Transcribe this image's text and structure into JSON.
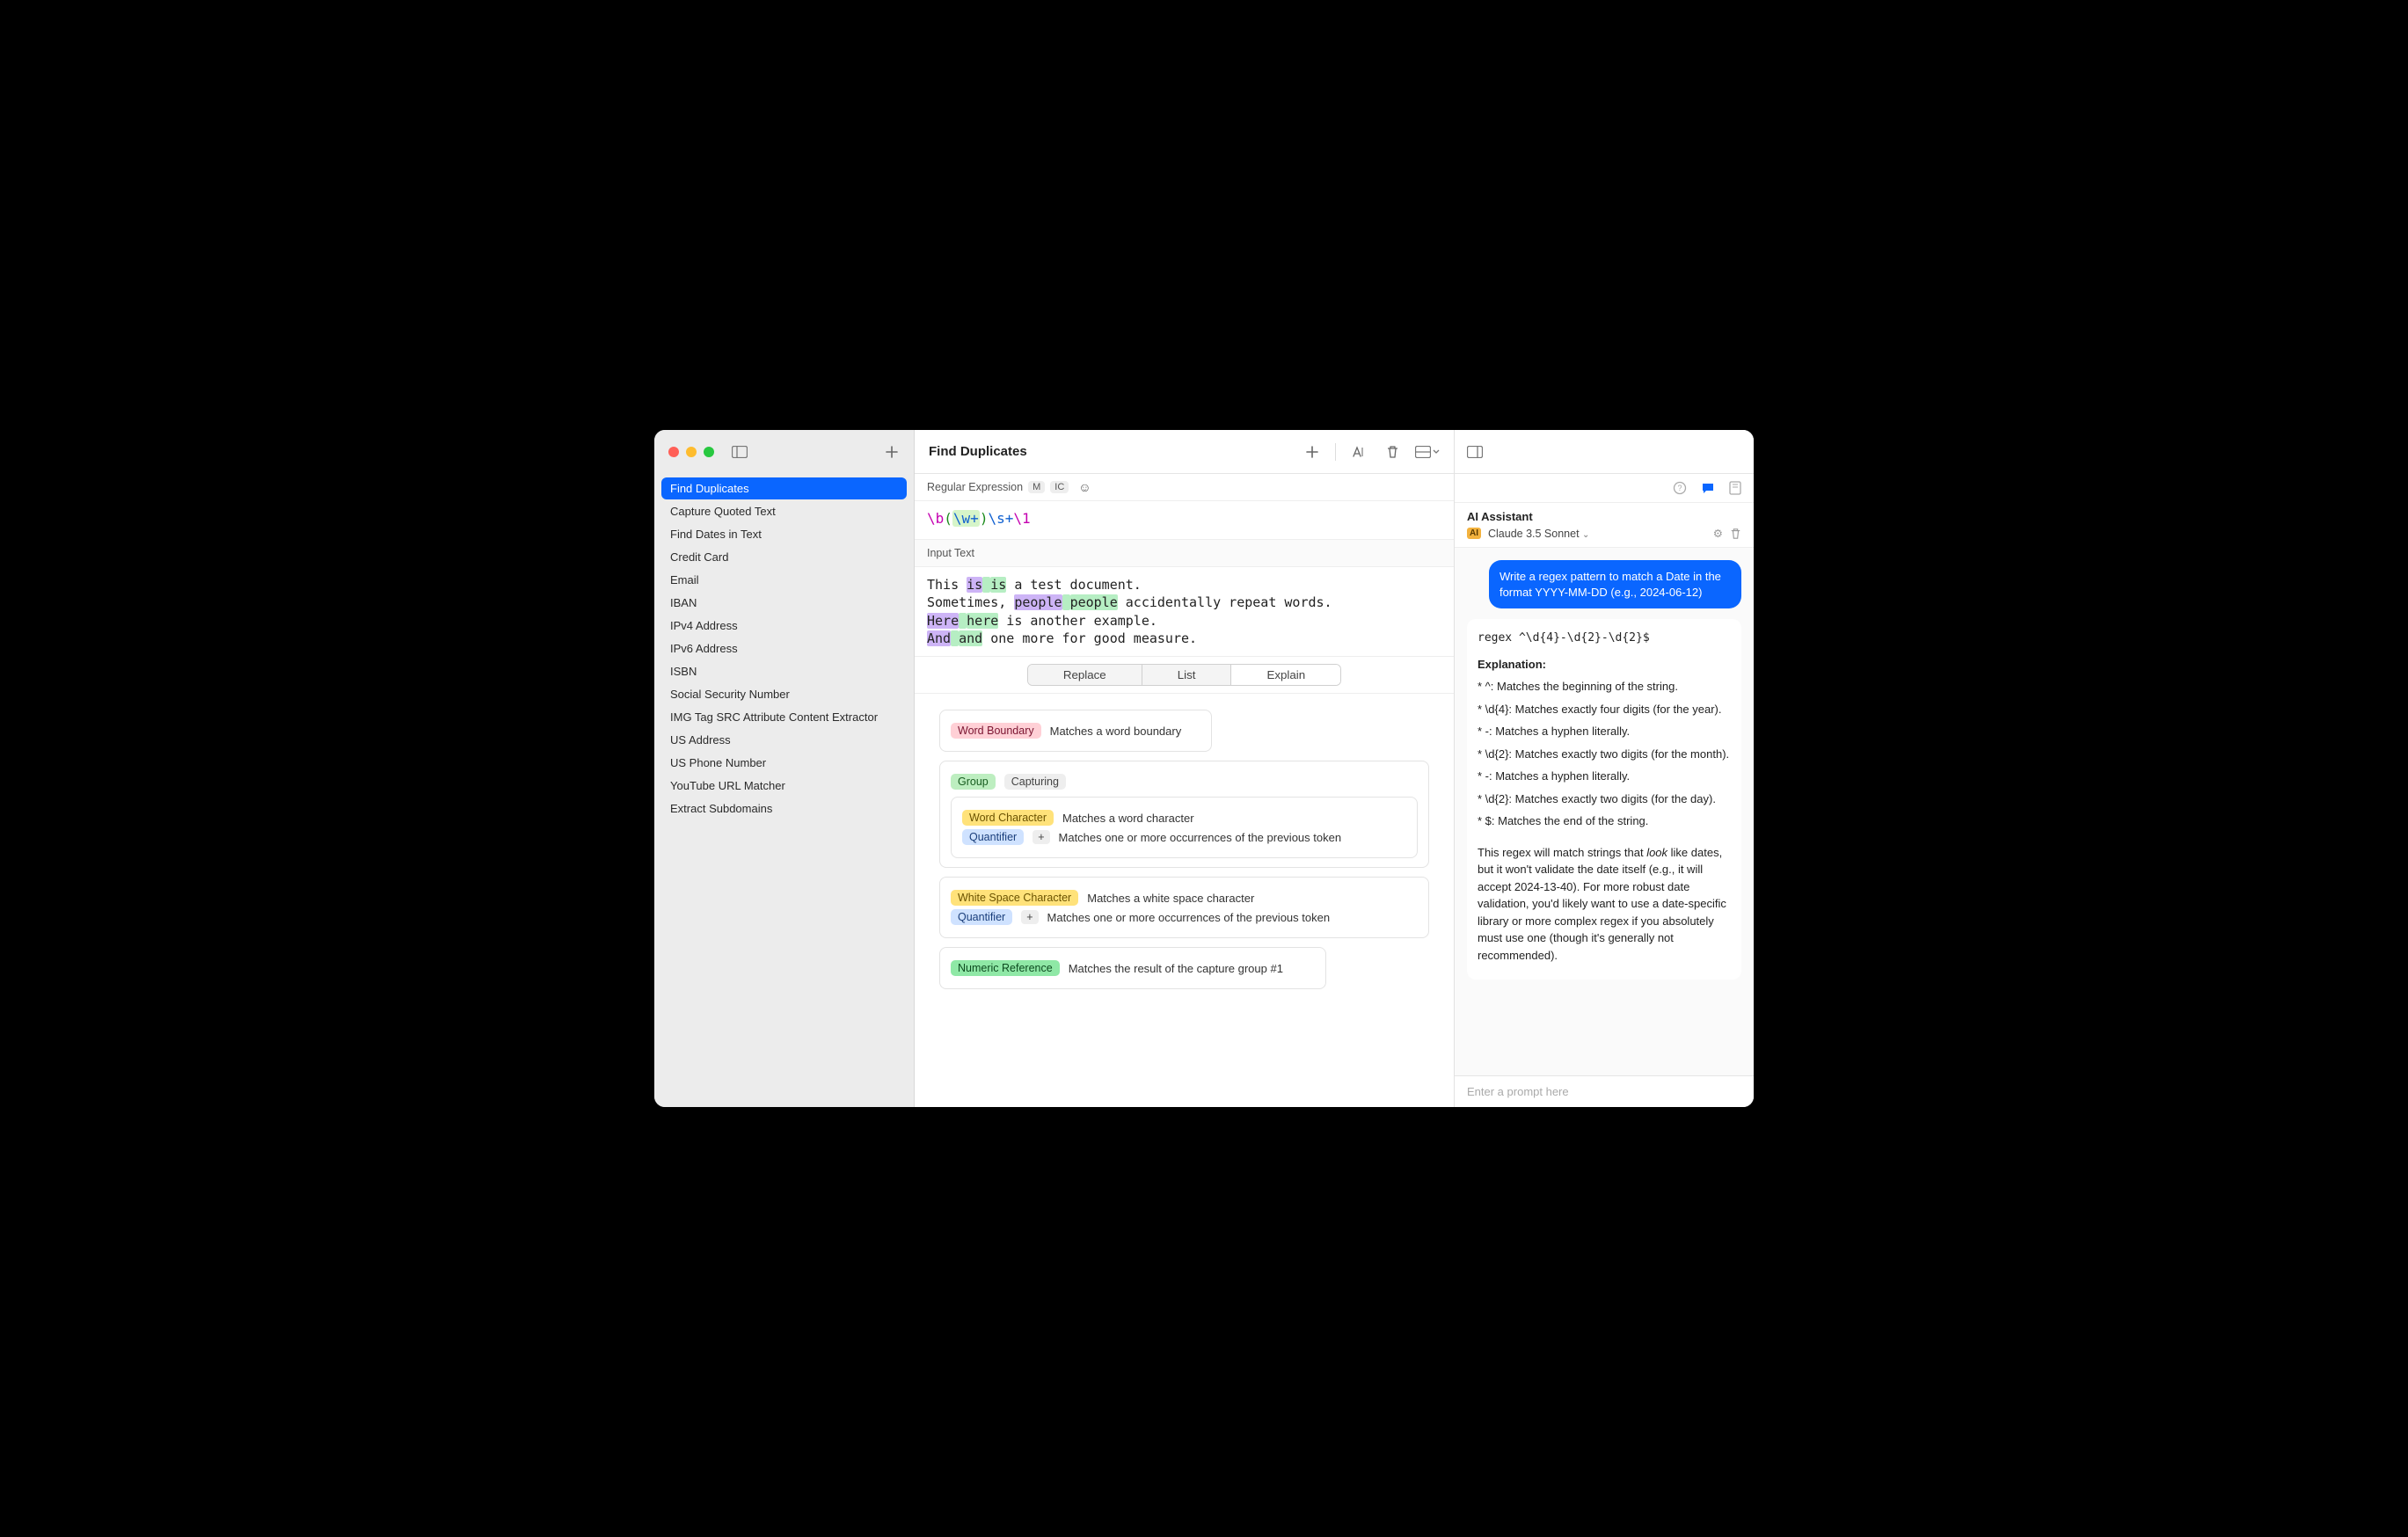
{
  "sidebar": {
    "items": [
      "Find Duplicates",
      "Capture Quoted Text",
      "Find Dates in Text",
      "Credit Card",
      "Email",
      "IBAN",
      "IPv4 Address",
      "IPv6 Address",
      "ISBN",
      "Social Security Number",
      "IMG Tag SRC Attribute Content Extractor",
      "US Address",
      "US Phone Number",
      "YouTube URL Matcher",
      "Extract Subdomains"
    ],
    "selected_index": 0
  },
  "main": {
    "title": "Find Duplicates",
    "regex_label": "Regular Expression",
    "flags": {
      "m": "M",
      "ic": "IC"
    },
    "regex_tokens": {
      "wb": "\\b",
      "open": "(",
      "wclass": "\\w",
      "plus1": "+",
      "close": ")",
      "ws": "\\s",
      "plus2": "+",
      "backref": "\\1"
    },
    "input_label": "Input Text",
    "tabs": {
      "replace": "Replace",
      "list": "List",
      "explain": "Explain"
    },
    "explain": {
      "word_boundary": {
        "label": "Word Boundary",
        "desc": "Matches a word boundary"
      },
      "group": {
        "label": "Group",
        "sub": "Capturing"
      },
      "word_char": {
        "label": "Word Character",
        "desc": "Matches a word character"
      },
      "quantifier": {
        "label": "Quantifier",
        "plus": "+",
        "desc": "Matches one or more occurrences of the previous token"
      },
      "wschar": {
        "label": "White Space Character",
        "desc": "Matches a white space character"
      },
      "numref": {
        "label": "Numeric Reference",
        "desc": "Matches the result of the capture group #1"
      }
    }
  },
  "ai": {
    "title": "AI Assistant",
    "model": "Claude 3.5 Sonnet",
    "user_message": "Write a regex pattern to match a Date in the format YYYY-MM-DD (e.g., 2024-06-12)",
    "assistant": {
      "code": "regex ^\\d{4}-\\d{2}-\\d{2}$",
      "explanation_heading": "Explanation:",
      "bullets": [
        "* ^: Matches the beginning of the string.",
        "* \\d{4}: Matches exactly four digits (for the year).",
        "* -: Matches a hyphen literally.",
        "* \\d{2}: Matches exactly two digits (for the month).",
        "* -: Matches a hyphen literally.",
        "* \\d{2}: Matches exactly two digits (for the day).",
        "* $: Matches the end of the string."
      ],
      "trailer_pre": "This regex will match strings that ",
      "trailer_em": "look",
      "trailer_post": " like dates, but it won't validate the date itself (e.g., it will accept 2024-13-40).  For more robust date validation, you'd likely want to use a date-specific library or more complex regex if you absolutely must use one (though it's generally not recommended)."
    },
    "prompt_placeholder": "Enter a prompt here"
  },
  "sample": {
    "l1a": "This ",
    "l1b": "is",
    "l1c": " ",
    "l1d": "is",
    "l1e": " a test document.",
    "l2a": "Sometimes, ",
    "l2b": "people",
    "l2c": " ",
    "l2d": "people",
    "l2e": " accidentally repeat words.",
    "l3a": "Here",
    "l3b": " ",
    "l3c": "here",
    "l3d": " is another example.",
    "l4a": "And",
    "l4b": " ",
    "l4c": "and",
    "l4d": " one more for good measure."
  }
}
